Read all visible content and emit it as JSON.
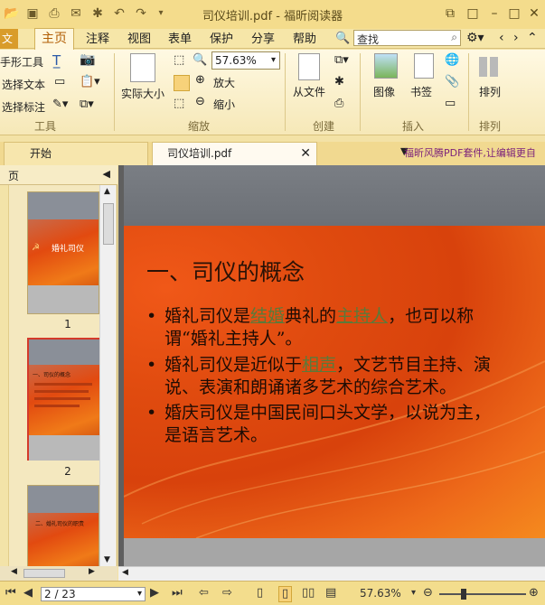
{
  "window": {
    "title": "司仪培训.pdf - 福昕阅读器"
  },
  "menu": {
    "file": "文件",
    "home": "主页",
    "items": [
      "注释",
      "视图",
      "表单",
      "保护",
      "分享",
      "帮助"
    ]
  },
  "search": {
    "value": "查找"
  },
  "ribbon": {
    "hand_tool": "手形工具",
    "select_text": "选择文本",
    "select_annot": "选择标注",
    "group_tools": "工具",
    "actual_size": "实际大小",
    "zoom_value": "57.63%",
    "zoom_in": "放大",
    "zoom_out": "缩小",
    "group_zoom": "缩放",
    "from_file": "从文件",
    "group_create": "创建",
    "image": "图像",
    "bookmark": "书签",
    "group_insert": "插入",
    "arrange": "排列",
    "group_arrange": "排列"
  },
  "tabs": {
    "start": "开始",
    "doc": "司仪培训.pdf",
    "promo": "福昕风腾PDF套件,让编辑更自"
  },
  "panel": {
    "title": "页",
    "thumbs": [
      {
        "num": "1",
        "title": "婚礼司仪"
      },
      {
        "num": "2",
        "title": "一、司仪的概念"
      },
      {
        "num": "3",
        "title": "二、婚礼司仪的职责"
      }
    ]
  },
  "slide": {
    "title": "一、司仪的概念",
    "bullets": [
      {
        "pre": "婚礼司仪是",
        "link1": "结婚",
        "mid": "典礼的",
        "link2": "主持人",
        "post": "，也可以称谓“婚礼主持人”。"
      },
      {
        "pre": "婚礼司仪是近似于",
        "link1": "相声",
        "post": "，文艺节目主持、演说、表演和朗诵诸多艺术的综合艺术。"
      },
      {
        "text": "婚庆司仪是中国民间口头文学，以说为主，是语言艺术。"
      }
    ]
  },
  "status": {
    "page": "2 / 23",
    "zoom": "57.63%"
  }
}
